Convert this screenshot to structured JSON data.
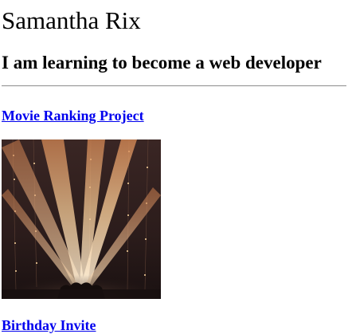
{
  "header": {
    "name": "Samantha Rix",
    "tagline": "I am learning to become a web developer"
  },
  "projects": [
    {
      "label": "Movie Ranking Project"
    },
    {
      "label": "Birthday Invite"
    }
  ],
  "colors": {
    "link": "#0000ee",
    "stage_background": "#2a1b1a",
    "light_beam": "#f0c48a"
  }
}
